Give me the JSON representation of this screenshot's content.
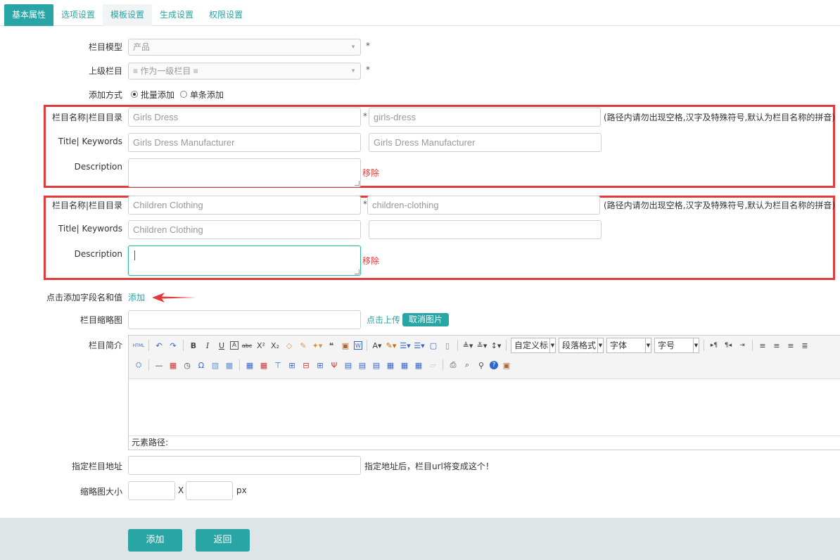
{
  "tabs": [
    {
      "label": "基本属性",
      "active": true
    },
    {
      "label": "选项设置",
      "active": false
    },
    {
      "label": "模板设置",
      "active": false,
      "hover": true
    },
    {
      "label": "生成设置",
      "active": false
    },
    {
      "label": "权限设置",
      "active": false
    }
  ],
  "form": {
    "model": {
      "label": "栏目模型",
      "value": "产品",
      "required": "*"
    },
    "parent": {
      "label": "上级栏目",
      "value": "≡ 作为一级栏目 ≡",
      "required": "*"
    },
    "add_mode": {
      "label": "添加方式",
      "options": [
        "批量添加",
        "单条添加"
      ],
      "selected": "批量添加"
    },
    "entries": [
      {
        "name_label": "栏目名称|栏目目录",
        "name_value": "Girls Dress",
        "dir_value": "girls-dress",
        "required": "*",
        "dir_hint": "(路径内请勿出现空格,汉字及特殊符号,默认为栏目名称的拼音)",
        "title_label": "Title| Keywords",
        "title_value": "Girls Dress Manufacturer",
        "keywords_value": "Girls Dress Manufacturer",
        "desc_label": "Description",
        "desc_value": "",
        "remove_label": "移除"
      },
      {
        "name_label": "栏目名称|栏目目录",
        "name_value": "Children Clothing",
        "dir_value": "children-clothing",
        "required": "*",
        "dir_hint": "(路径内请勿出现空格,汉字及特殊符号,默认为栏目名称的拼音)",
        "title_label": "Title| Keywords",
        "title_value": "Children Clothing",
        "keywords_value": "",
        "desc_label": "Description",
        "desc_value": "",
        "remove_label": "移除"
      }
    ],
    "add_field": {
      "label": "点击添加字段名和值",
      "link": "添加"
    },
    "thumbnail": {
      "label": "栏目缩略图",
      "value": "",
      "upload": "点击上传",
      "cancel": "取消图片"
    },
    "intro": {
      "label": "栏目简介",
      "combos": [
        "自定义标",
        "段落格式",
        "字体",
        "字号"
      ],
      "path_label": "元素路径:"
    },
    "custom_url": {
      "label": "指定栏目地址",
      "value": "",
      "hint": "指定地址后，栏目url将变成这个！"
    },
    "thumb_size": {
      "label": "缩略图大小",
      "width": "",
      "height": "",
      "x": "X",
      "unit": "px"
    }
  },
  "footer": {
    "submit": "添加",
    "back": "返回"
  },
  "colors": {
    "accent": "#2aa5a5",
    "highlight": "#e23b3b",
    "footer_bg": "#dfe5e6"
  }
}
